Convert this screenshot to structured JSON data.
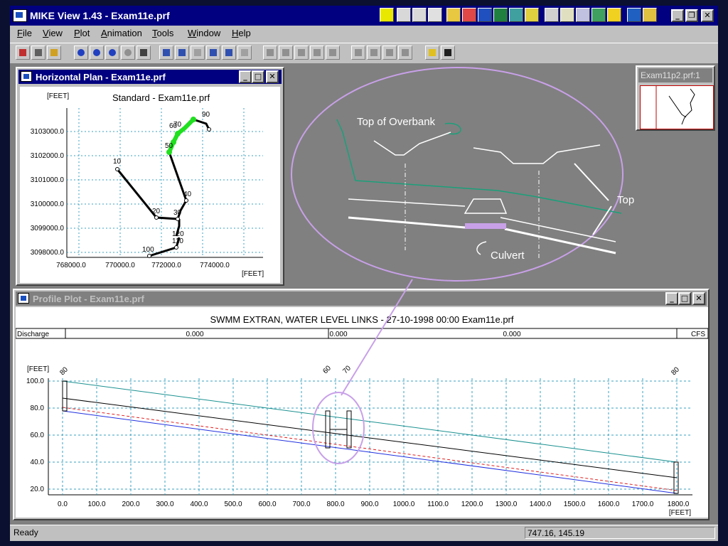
{
  "app": {
    "title": "MIKE View 1.43 - Exam11e.prf"
  },
  "menu": [
    "File",
    "View",
    "Plot",
    "Animation",
    "Tools",
    "Window",
    "Help"
  ],
  "horizontal_plan": {
    "title": "Horizontal Plan - Exam11e.prf",
    "chart_title": "Standard - Exam11e.prf",
    "y_unit": "[FEET]",
    "x_unit": "[FEET]",
    "y_ticks": [
      "3103000.0",
      "3102000.0",
      "3101000.0",
      "3100000.0",
      "3099000.0",
      "3098000.0"
    ],
    "x_ticks": [
      "768000.0",
      "770000.0",
      "772000.0",
      "774000.0"
    ],
    "node_labels": [
      "10",
      "20",
      "30",
      "40",
      "50",
      "60",
      "70",
      "90",
      "100",
      "110",
      "120"
    ]
  },
  "overview": {
    "title": "Exam11p2.prf:1"
  },
  "callout": {
    "top_of_overbank": "Top of Overbank",
    "top_of_bank": "Top of Bank",
    "culvert": "Culvert",
    "highlight_color": "#c8a0e8",
    "teal_color": "#1aa07a"
  },
  "profile": {
    "title": "Profile Plot - Exam11e.prf",
    "chart_title": "SWMM EXTRAN, WATER LEVEL LINKS - 27-10-1998 00:00 Exam11e.prf",
    "discharge_label": "Discharge",
    "discharge_values": [
      "0.000",
      "0.000",
      "0.000"
    ],
    "discharge_unit": "CFS",
    "y_unit": "[FEET]",
    "x_unit": "[FEET]",
    "y_ticks": [
      "100.0",
      "80.0",
      "60.0",
      "40.0",
      "20.0"
    ],
    "x_ticks": [
      "0.0",
      "100.0",
      "200.0",
      "300.0",
      "400.0",
      "500.0",
      "600.0",
      "700.0",
      "800.0",
      "900.0",
      "1000.0",
      "1100.0",
      "1200.0",
      "1300.0",
      "1400.0",
      "1500.0",
      "1600.0",
      "1700.0",
      "1800.0"
    ],
    "node_labels": [
      "80",
      "60",
      "70",
      "80"
    ]
  },
  "status": {
    "left": "Ready",
    "coords": "747.16, 145.19"
  }
}
